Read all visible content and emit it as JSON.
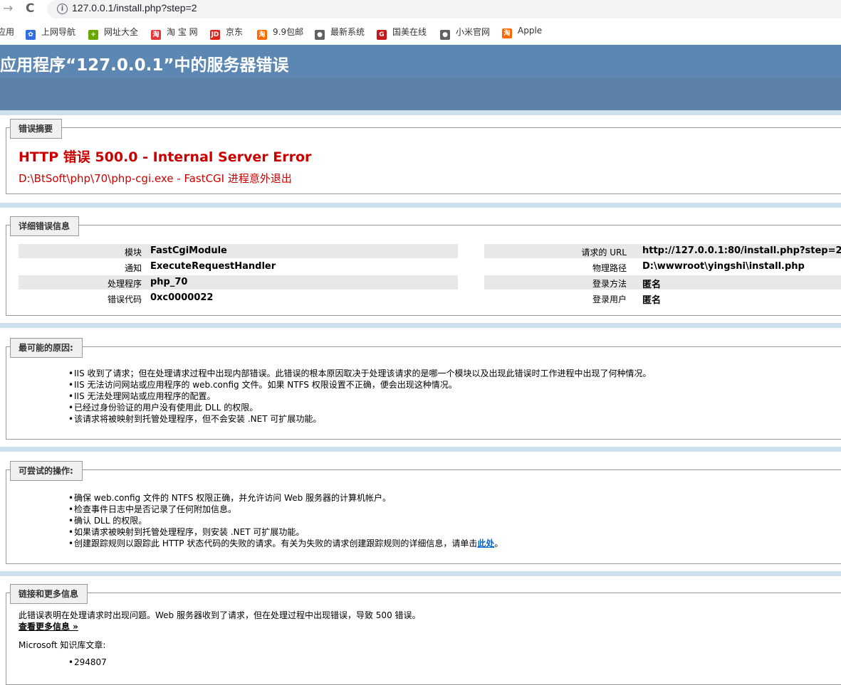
{
  "browser": {
    "url": "127.0.0.1/install.php?step=2",
    "back_icon": "→",
    "reload_icon": "C",
    "bookmarks": [
      {
        "label": "应用",
        "icon": "apps-icon",
        "color": "#4285f4"
      },
      {
        "label": "上网导航",
        "icon": "paw-icon",
        "color": "#2f6de1"
      },
      {
        "label": "网址大全",
        "icon": "plus-circle-icon",
        "color": "#6aa700"
      },
      {
        "label": "淘 宝 网",
        "icon": "taobao-icon",
        "color": "#e4393c"
      },
      {
        "label": "京东",
        "icon": "jd-icon",
        "color": "#e1251b"
      },
      {
        "label": "9.9包邮",
        "icon": "taobao-icon",
        "color": "#ff6a00"
      },
      {
        "label": "最新系统",
        "icon": "globe-icon",
        "color": "#5f6368"
      },
      {
        "label": "国美在线",
        "icon": "gome-icon",
        "color": "#c8161d"
      },
      {
        "label": "小米官网",
        "icon": "globe-icon",
        "color": "#5f6368"
      },
      {
        "label": "Apple",
        "icon": "taobao-icon",
        "color": "#ff6a00"
      }
    ]
  },
  "header": {
    "title": "应用程序“127.0.0.1”中的服务器错误",
    "bg_color": "#5c87b2"
  },
  "summary": {
    "legend": "错误摘要",
    "title": "HTTP 错误 500.0 - Internal Server Error",
    "subtitle": "D:\\BtSoft\\php\\70\\php-cgi.exe - FastCGI 进程意外退出",
    "color": "#cc0000"
  },
  "details": {
    "legend": "详细错误信息",
    "left": [
      {
        "label": "模块",
        "value": "FastCgiModule"
      },
      {
        "label": "通知",
        "value": "ExecuteRequestHandler"
      },
      {
        "label": "处理程序",
        "value": "php_70"
      },
      {
        "label": "错误代码",
        "value": "0xc0000022"
      }
    ],
    "right": [
      {
        "label": "请求的 URL",
        "value": "http://127.0.0.1:80/install.php?step=2"
      },
      {
        "label": "物理路径",
        "value": "D:\\wwwroot\\yingshi\\install.php"
      },
      {
        "label": "登录方法",
        "value": "匿名"
      },
      {
        "label": "登录用户",
        "value": "匿名"
      }
    ]
  },
  "causes": {
    "legend": "最可能的原因:",
    "items": [
      "IIS 收到了请求；但在处理请求过程中出现内部错误。此错误的根本原因取决于处理该请求的是哪一个模块以及出现此错误时工作进程中出现了何种情况。",
      "IIS 无法访问网站或应用程序的 web.config 文件。如果 NTFS 权限设置不正确，便会出现这种情况。",
      "IIS 无法处理网站或应用程序的配置。",
      "已经过身份验证的用户没有使用此 DLL 的权限。",
      "该请求将被映射到托管处理程序，但不会安装 .NET 可扩展功能。"
    ]
  },
  "actions": {
    "legend": "可尝试的操作:",
    "items": [
      "确保 web.config 文件的 NTFS 权限正确，并允许访问 Web 服务器的计算机帐户。",
      "检查事件日志中是否记录了任何附加信息。",
      "确认 DLL 的权限。",
      "如果请求被映射到托管处理程序，则安装 .NET 可扩展功能。"
    ],
    "last_item_text": "创建跟踪规则以跟踪此 HTTP 状态代码的失败的请求。有关为失败的请求创建跟踪规则的详细信息，请单击",
    "last_item_link": "此处",
    "last_item_end": "。"
  },
  "links": {
    "legend": "链接和更多信息",
    "description": "此错误表明在处理请求时出现问题。Web 服务器收到了请求，但在处理过程中出现错误，导致 500 错误。",
    "more_link": "查看更多信息 »",
    "kb_label": "Microsoft 知识库文章:",
    "kb_items": [
      "294807"
    ]
  }
}
